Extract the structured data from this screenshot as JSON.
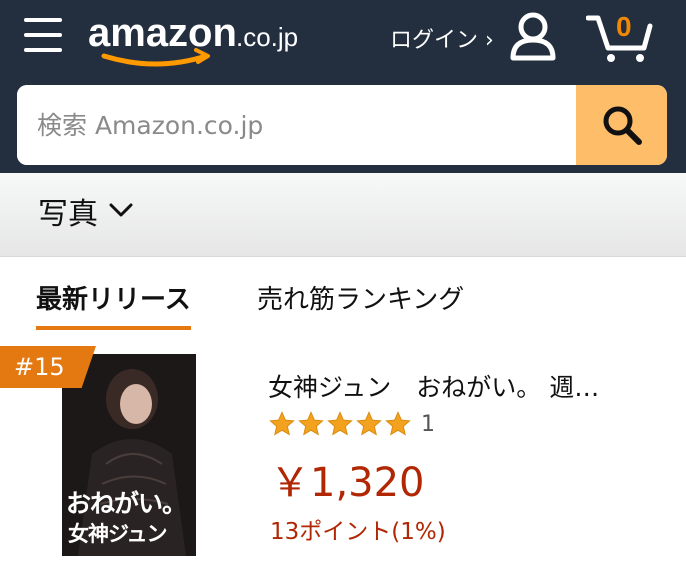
{
  "header": {
    "logo_text": "amazon",
    "logo_domain": ".co.jp",
    "login_label": "ログイン ›",
    "cart_count": "0",
    "background_color": "#232f3e"
  },
  "search": {
    "placeholder": "検索 Amazon.co.jp",
    "button_color": "#febd69"
  },
  "subnav": {
    "category_label": "写真"
  },
  "tabs": [
    {
      "label": "最新リリース",
      "active": true
    },
    {
      "label": "売れ筋ランキング",
      "active": false
    }
  ],
  "product": {
    "rank": "#15",
    "cover_text_line1": "おねがい。",
    "cover_text_line2": "女神ジュン",
    "title": "女神ジュン　おねがい。 週…",
    "rating": 5,
    "review_count": "1",
    "price": "￥1,320",
    "points": "13ポイント(1%)"
  },
  "colors": {
    "accent_orange": "#e47911",
    "price_red": "#b12704",
    "star_color": "#f2a21e"
  }
}
